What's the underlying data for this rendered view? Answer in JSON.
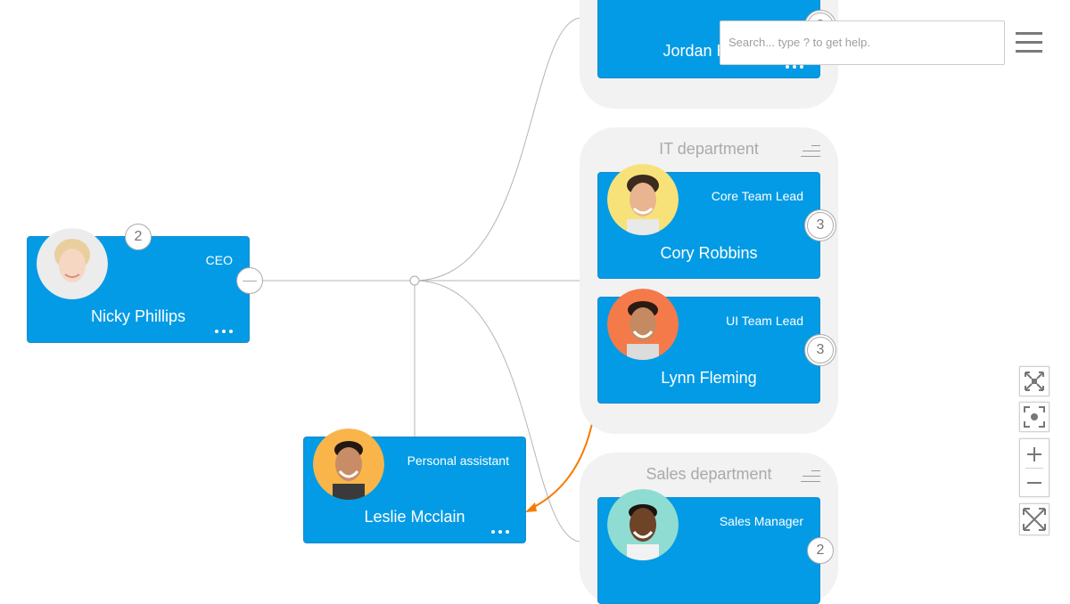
{
  "search": {
    "placeholder": "Search... type ? to get help."
  },
  "menu": {
    "icon": "hamburger-menu-icon"
  },
  "colors": {
    "node": "#039be5",
    "group": "#f2f2f2",
    "link": "#aaaaaa",
    "assistant_link": "#f57c00"
  },
  "groups": {
    "top": {
      "title": ""
    },
    "it": {
      "title": "IT department"
    },
    "sales": {
      "title": "Sales department"
    }
  },
  "nodes": {
    "nicky": {
      "name": "Nicky Phillips",
      "title": "CEO",
      "count": "2"
    },
    "jordan": {
      "name": "Jordan H",
      "title": "",
      "count": "3"
    },
    "cory": {
      "name": "Cory Robbins",
      "title": "Core Team Lead",
      "count": "3"
    },
    "lynn": {
      "name": "Lynn Fleming",
      "title": "UI Team Lead",
      "count": "3"
    },
    "leslie": {
      "name": "Leslie Mcclain",
      "title": "Personal assistant"
    },
    "sales_mgr": {
      "name": "",
      "title": "Sales Manager",
      "count": "2"
    }
  },
  "controls": [
    "fit-icon",
    "focus-icon",
    "zoom-in-icon",
    "zoom-out-icon",
    "fullscreen-icon"
  ]
}
